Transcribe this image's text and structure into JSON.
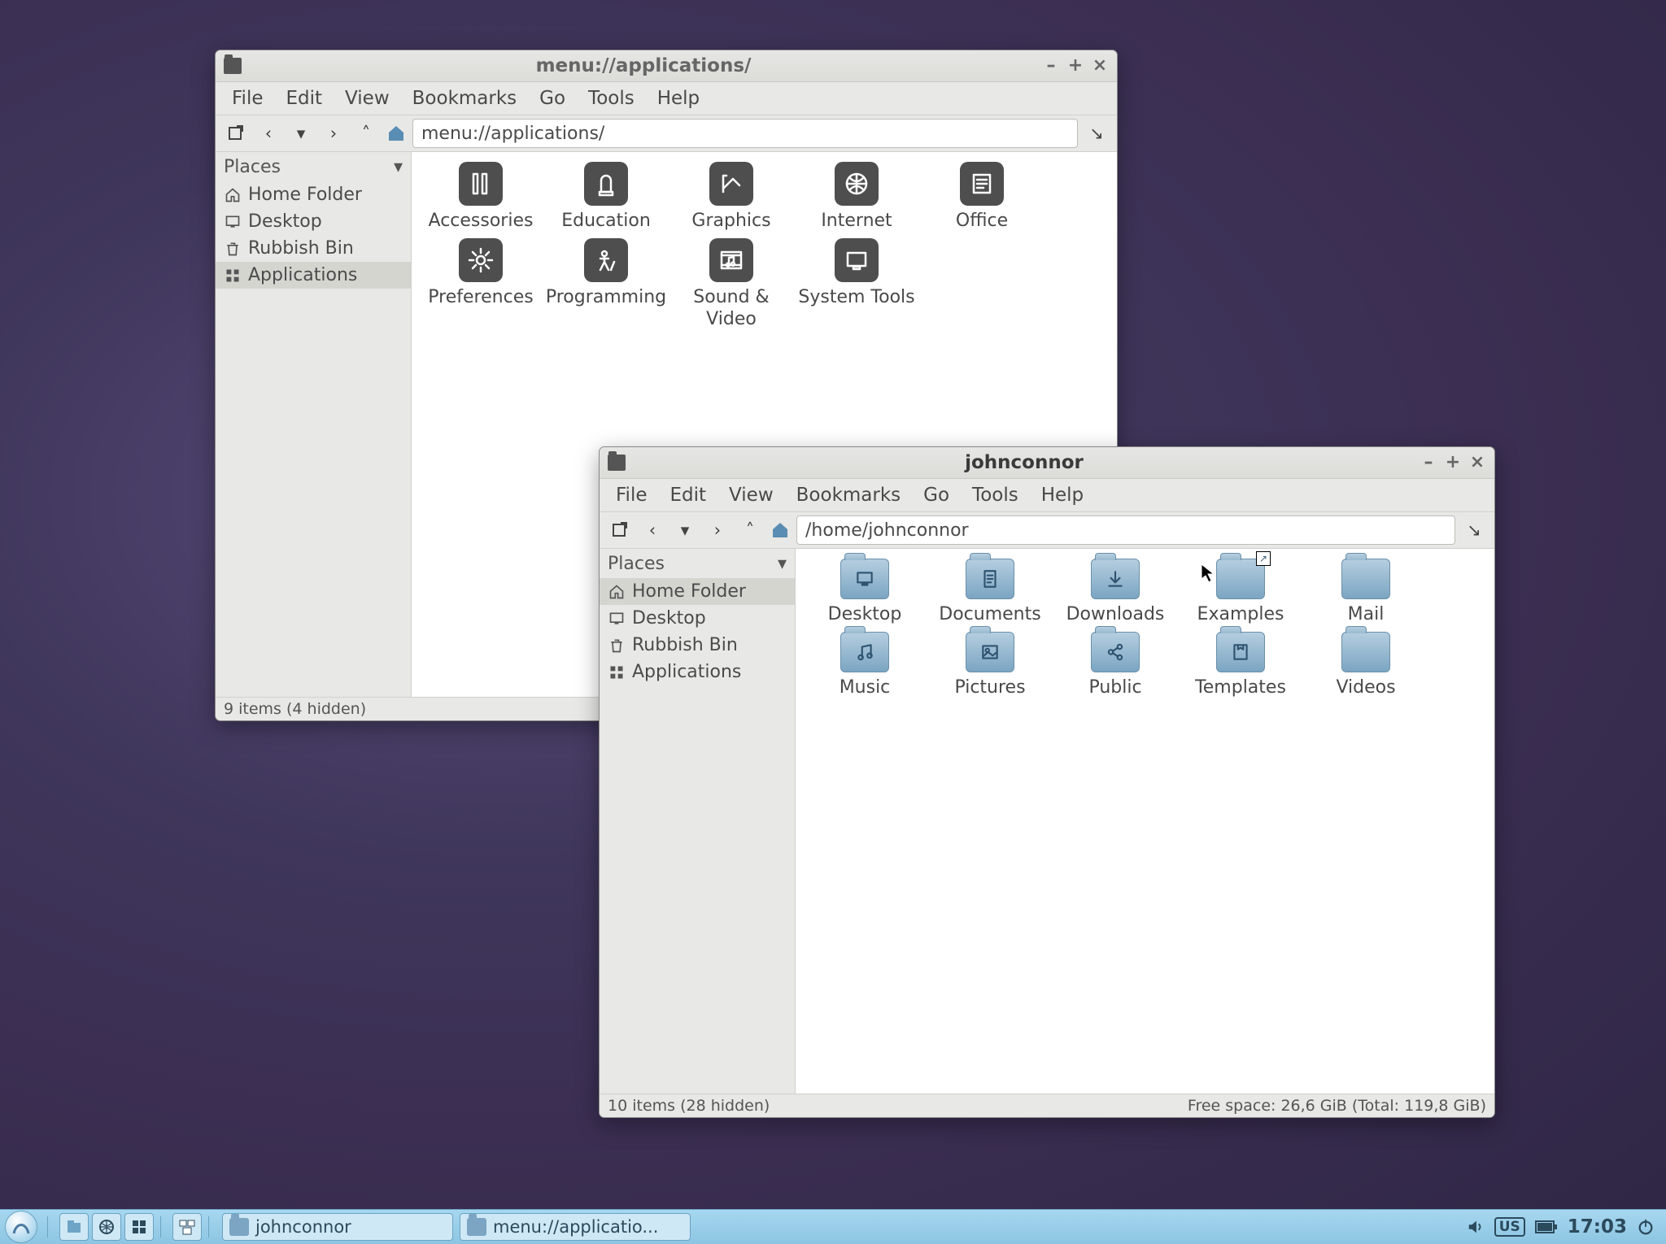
{
  "window1": {
    "title": "menu://applications/",
    "path": "menu://applications/",
    "menubar": [
      "File",
      "Edit",
      "View",
      "Bookmarks",
      "Go",
      "Tools",
      "Help"
    ],
    "places_header": "Places",
    "places": [
      {
        "label": "Home Folder",
        "icon": "home"
      },
      {
        "label": "Desktop",
        "icon": "desktop"
      },
      {
        "label": "Rubbish Bin",
        "icon": "trash"
      },
      {
        "label": "Applications",
        "icon": "apps",
        "selected": true
      }
    ],
    "items": [
      {
        "label": "Accessories",
        "icon": "accessories"
      },
      {
        "label": "Education",
        "icon": "education"
      },
      {
        "label": "Graphics",
        "icon": "graphics"
      },
      {
        "label": "Internet",
        "icon": "internet"
      },
      {
        "label": "Office",
        "icon": "office"
      },
      {
        "label": "Preferences",
        "icon": "preferences"
      },
      {
        "label": "Programming",
        "icon": "programming"
      },
      {
        "label": "Sound & Video",
        "icon": "soundvideo"
      },
      {
        "label": "System Tools",
        "icon": "systemtools"
      }
    ],
    "status_left": "9 items (4 hidden)",
    "status_right": ""
  },
  "window2": {
    "title": "johnconnor",
    "path": "/home/johnconnor",
    "menubar": [
      "File",
      "Edit",
      "View",
      "Bookmarks",
      "Go",
      "Tools",
      "Help"
    ],
    "places_header": "Places",
    "places": [
      {
        "label": "Home Folder",
        "icon": "home",
        "selected": true
      },
      {
        "label": "Desktop",
        "icon": "desktop"
      },
      {
        "label": "Rubbish Bin",
        "icon": "trash"
      },
      {
        "label": "Applications",
        "icon": "apps"
      }
    ],
    "items": [
      {
        "label": "Desktop",
        "icon": "f-desktop"
      },
      {
        "label": "Documents",
        "icon": "f-docs"
      },
      {
        "label": "Downloads",
        "icon": "f-down"
      },
      {
        "label": "Examples",
        "icon": "f-link"
      },
      {
        "label": "Mail",
        "icon": "f-plain"
      },
      {
        "label": "Music",
        "icon": "f-music"
      },
      {
        "label": "Pictures",
        "icon": "f-pics"
      },
      {
        "label": "Public",
        "icon": "f-share"
      },
      {
        "label": "Templates",
        "icon": "f-tmpl"
      },
      {
        "label": "Videos",
        "icon": "f-plain"
      }
    ],
    "status_left": "10 items (28 hidden)",
    "status_right": "Free space: 26,6 GiB (Total: 119,8 GiB)"
  },
  "taskbar": {
    "items": [
      {
        "label": "johnconnor"
      },
      {
        "label": "menu://applicatio..."
      }
    ],
    "tray_kb": "US",
    "tray_time": "17:03"
  }
}
